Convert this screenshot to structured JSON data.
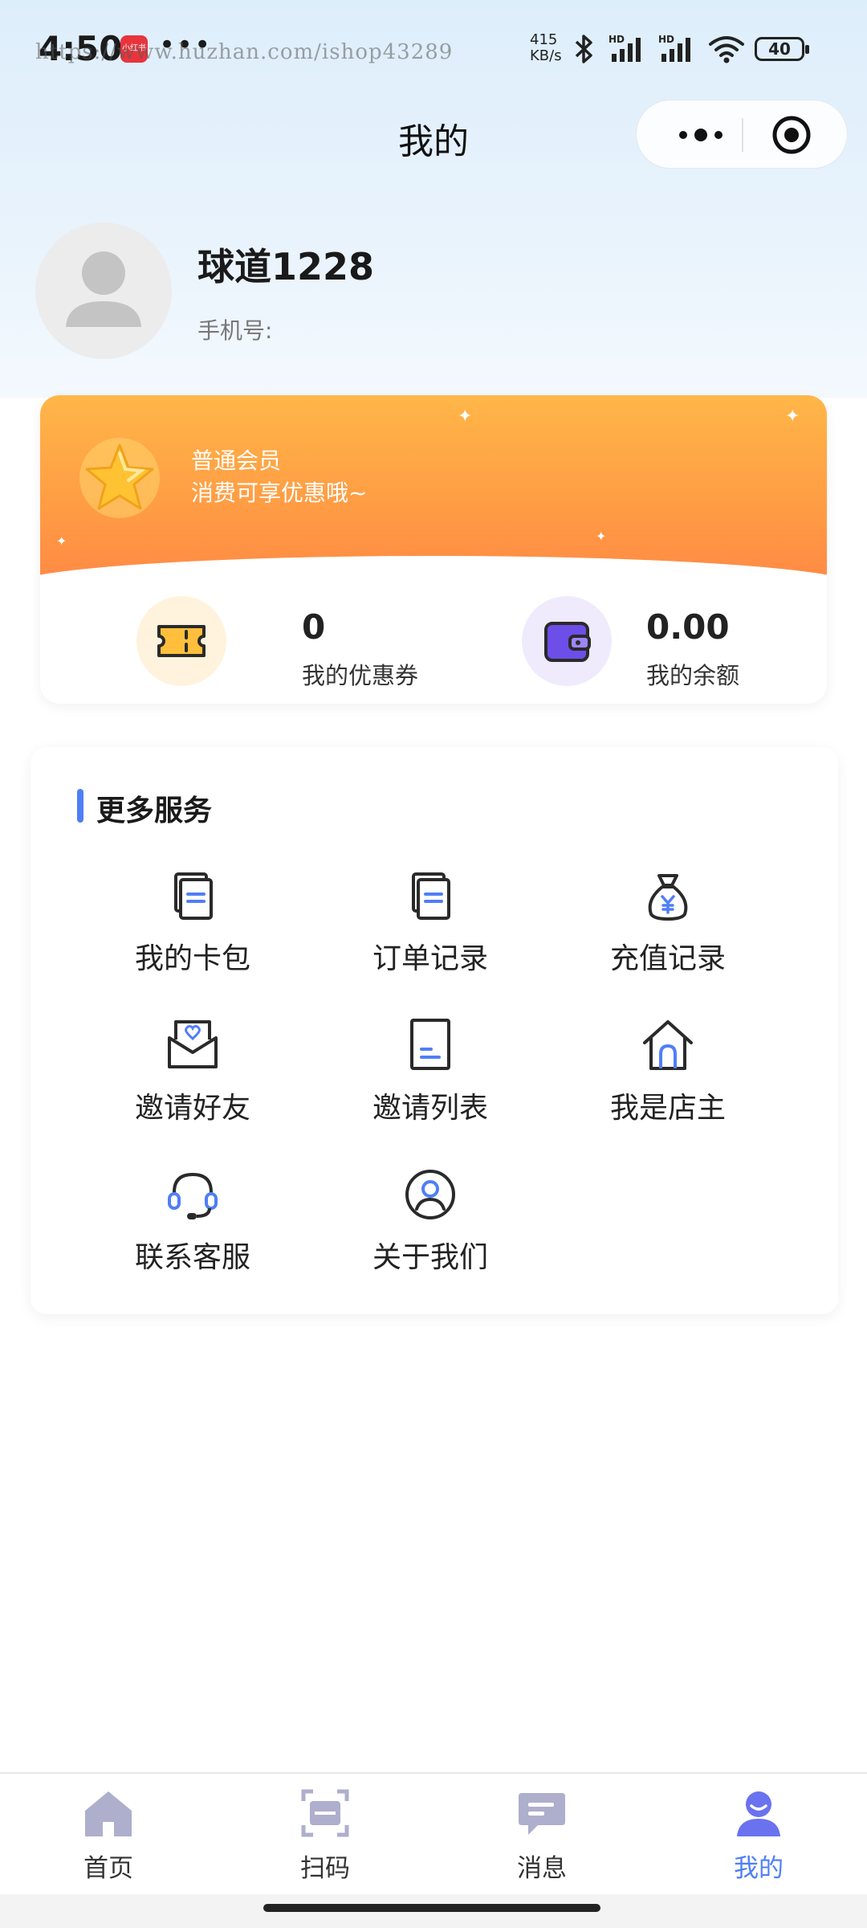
{
  "status_bar": {
    "time": "4:50",
    "app_icon_text": "小红书",
    "more_dots": "•••",
    "watermark": "https://www.huzhan.com/ishop43289",
    "net_speed_value": "415",
    "net_speed_unit": "KB/s",
    "battery": "40"
  },
  "header": {
    "title": "我的"
  },
  "profile": {
    "username": "球道1228",
    "phone_label": "手机号:"
  },
  "member_card": {
    "level": "普通会员",
    "description": "消费可享优惠哦~",
    "coupons": {
      "value": "0",
      "label": "我的优惠券"
    },
    "balance": {
      "value": "0.00",
      "label": "我的余额"
    }
  },
  "services": {
    "title": "更多服务",
    "items": [
      {
        "label": "我的卡包",
        "icon": "card-wallet-icon"
      },
      {
        "label": "订单记录",
        "icon": "order-record-icon"
      },
      {
        "label": "充值记录",
        "icon": "recharge-bag-icon"
      },
      {
        "label": "邀请好友",
        "icon": "invite-envelope-icon"
      },
      {
        "label": "邀请列表",
        "icon": "invite-list-icon"
      },
      {
        "label": "我是店主",
        "icon": "shop-home-icon"
      },
      {
        "label": "联系客服",
        "icon": "headset-icon"
      },
      {
        "label": "关于我们",
        "icon": "user-circle-icon"
      }
    ]
  },
  "tabbar": {
    "items": [
      {
        "label": "首页",
        "icon": "home-icon"
      },
      {
        "label": "扫码",
        "icon": "scan-icon"
      },
      {
        "label": "消息",
        "icon": "message-icon"
      },
      {
        "label": "我的",
        "icon": "profile-icon",
        "active": true
      }
    ]
  },
  "colors": {
    "accent": "#4f7ef7",
    "card_gradient_top": "#ffb648",
    "card_gradient_bottom": "#ff8a45",
    "icon_gray": "#b3b3cf"
  }
}
